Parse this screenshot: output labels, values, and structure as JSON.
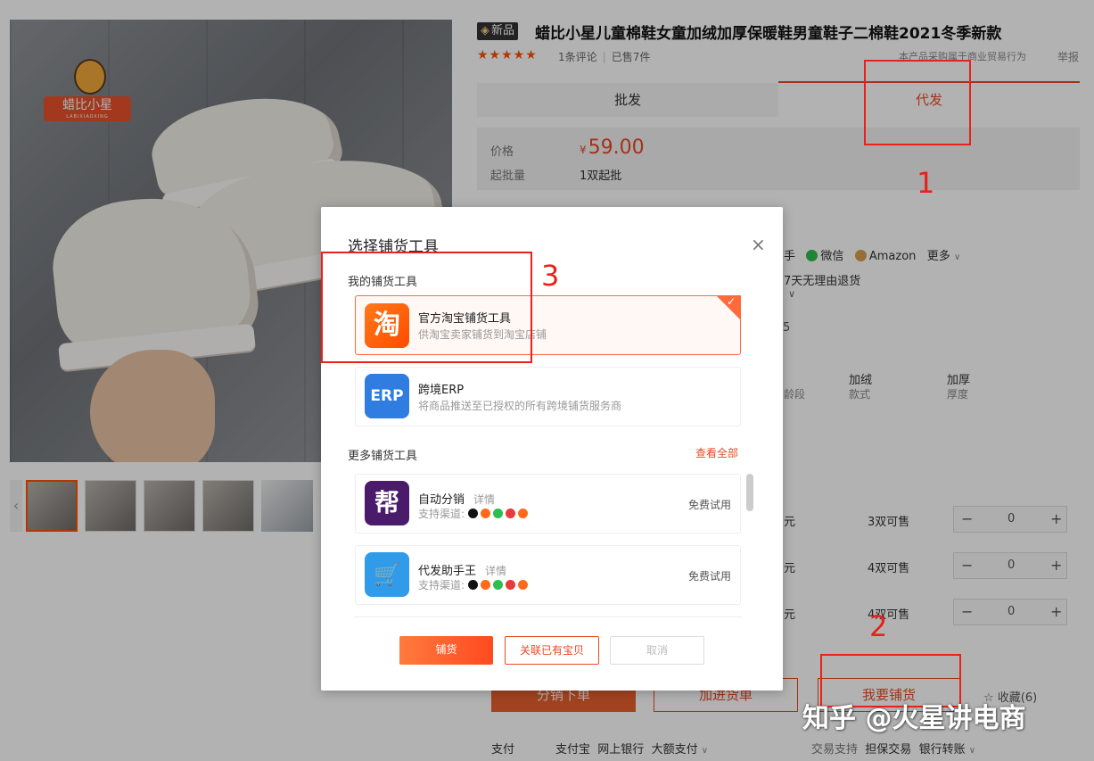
{
  "product": {
    "new_badge": "新品",
    "title": "蜡比小星儿童棉鞋女童加绒加厚保暖鞋男童鞋子二棉鞋2021冬季新款",
    "stars": "★★★★★",
    "reviews": "1条评论",
    "sold": "已售7件",
    "notice": "本产品采购属于商业贸易行为",
    "report": "举报",
    "brand_logo_text": "蜡比小星",
    "brand_logo_sub": "LABIXIAOXING"
  },
  "tabs": {
    "wholesale": "批发",
    "dropship": "代发"
  },
  "price": {
    "label": "价格",
    "currency": "¥",
    "value": "59.00",
    "moq_label": "起批量",
    "moq_value": "1双起批"
  },
  "channels": {
    "partial": "手",
    "wechat": "微信",
    "amazon": "Amazon",
    "more": "更多"
  },
  "return_policy": "7天无理由退货",
  "partial_number": "5",
  "attributes": [
    {
      "value": "",
      "key": "龄段"
    },
    {
      "value": "加绒",
      "key": "款式"
    },
    {
      "value": "加厚",
      "key": "厚度"
    }
  ],
  "sku_rows": [
    {
      "partial": "元",
      "stock": "3双可售",
      "qty": "0"
    },
    {
      "partial": "元",
      "stock": "4双可售",
      "qty": "0"
    },
    {
      "partial": "元",
      "stock": "4双可售",
      "qty": "0"
    }
  ],
  "stepper": {
    "minus": "−",
    "plus": "+"
  },
  "actions": {
    "order": "分销下单",
    "cart": "加进货单",
    "distribute": "我要铺货",
    "favorite": "☆ 收藏(6)"
  },
  "payment": {
    "label": "支付",
    "alipay": "支付宝",
    "bank": "网上银行",
    "credit": "大额支付",
    "trade_label": "交易支持",
    "escrow": "担保交易",
    "transfer": "银行转账"
  },
  "modal": {
    "title": "选择铺货工具",
    "close": "×",
    "my_tools_label": "我的铺货工具",
    "my_tools": [
      {
        "name": "官方淘宝铺货工具",
        "desc": "供淘宝卖家铺货到淘宝店铺",
        "icon": "淘"
      },
      {
        "name": "跨境ERP",
        "desc": "将商品推送至已授权的所有跨境铺货服务商",
        "icon": "ERP"
      }
    ],
    "more_tools_label": "更多铺货工具",
    "view_all": "查看全部",
    "more_tools": [
      {
        "name": "自动分销",
        "detail": "详情",
        "support": "支持渠道:",
        "trial": "免费试用",
        "icon": "帮"
      },
      {
        "name": "代发助手王",
        "detail": "详情",
        "support": "支持渠道:",
        "trial": "免费试用",
        "icon": "🛒"
      }
    ],
    "btn_distribute": "铺货",
    "btn_link": "关联已有宝贝",
    "btn_cancel": "取消"
  },
  "annotations": {
    "n1": "1",
    "n2": "2",
    "n3": "3"
  },
  "watermark": "知乎 @火星讲电商",
  "colors": {
    "accent": "#e84a24",
    "annotation": "#e8211a",
    "taobao": "#ff5000",
    "erp": "#2f7de1",
    "bang": "#4a1a6b",
    "helper": "#2f9be9"
  }
}
